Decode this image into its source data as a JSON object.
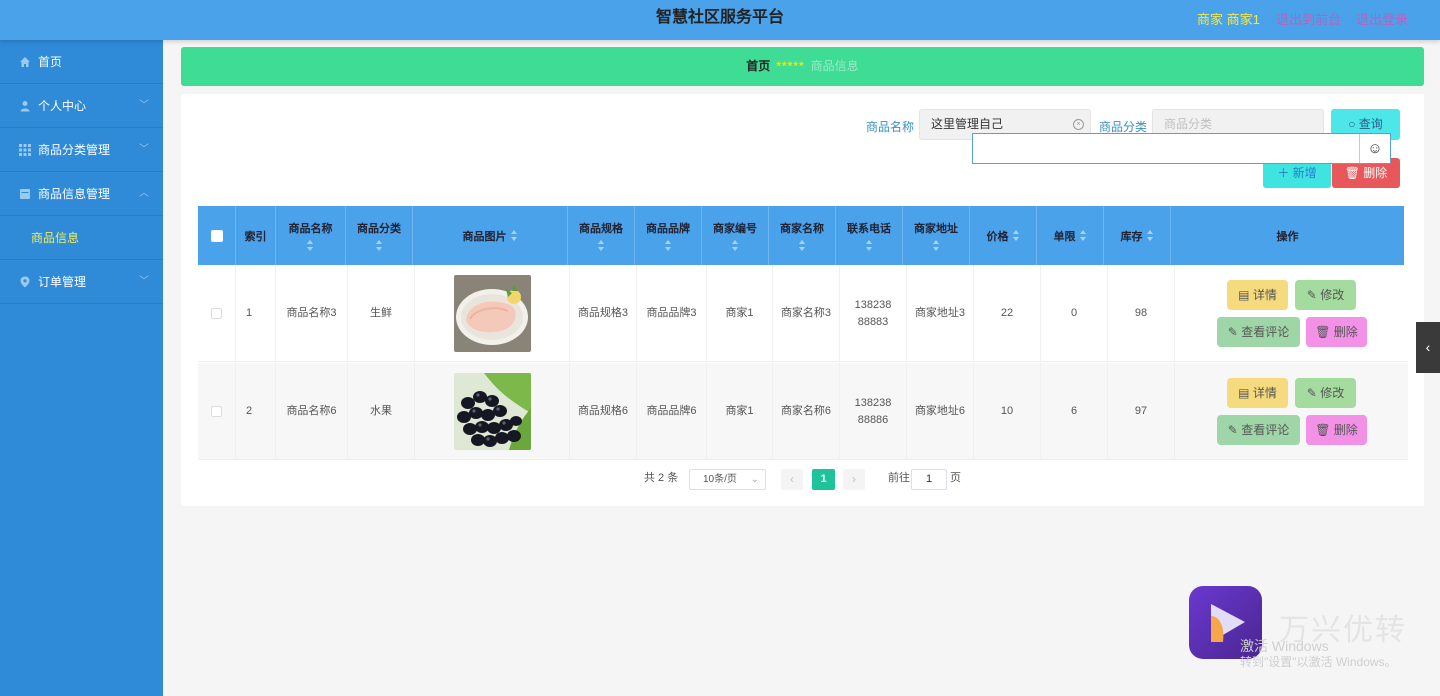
{
  "header": {
    "title": "智慧社区服务平台",
    "user": "商家 商家1",
    "back_link": "退出到前台",
    "logout_link": "退出登录"
  },
  "sidebar": {
    "items": [
      {
        "label": "首页",
        "icon": "home-icon"
      },
      {
        "label": "个人中心",
        "icon": "user-icon"
      },
      {
        "label": "商品分类管理",
        "icon": "grid-icon"
      },
      {
        "label": "商品信息管理",
        "icon": "box-icon"
      },
      {
        "label": "订单管理",
        "icon": "pin-icon"
      }
    ],
    "sub_item": "商品信息"
  },
  "breadcrumb": {
    "home": "首页",
    "separator": "*****",
    "current": "商品信息"
  },
  "search": {
    "name_label": "商品名称",
    "name_value": "这里管理自己",
    "category_label": "商品分类",
    "category_placeholder": "商品分类",
    "query_button": "查询"
  },
  "actions": {
    "add": "新增",
    "delete": "删除"
  },
  "table": {
    "headers": [
      "索引",
      "商品名称",
      "商品分类",
      "商品图片",
      "商品规格",
      "商品品牌",
      "商家编号",
      "商家名称",
      "联系电话",
      "商家地址",
      "价格",
      "单限",
      "库存",
      "操作"
    ],
    "rows": [
      {
        "index": "1",
        "name": "商品名称3",
        "category": "生鲜",
        "image": "chicken-breast",
        "spec": "商品规格3",
        "brand": "商品品牌3",
        "merchant_no": "商家1",
        "merchant_name": "商家名称3",
        "phone": "13823888883",
        "address": "商家地址3",
        "price": "22",
        "limit": "0",
        "stock": "98"
      },
      {
        "index": "2",
        "name": "商品名称6",
        "category": "水果",
        "image": "grapes",
        "spec": "商品规格6",
        "brand": "商品品牌6",
        "merchant_no": "商家1",
        "merchant_name": "商家名称6",
        "phone": "13823888886",
        "address": "商家地址6",
        "price": "10",
        "limit": "6",
        "stock": "97"
      }
    ],
    "row_buttons": {
      "detail": "详情",
      "edit": "修改",
      "comment": "查看评论",
      "delete": "删除"
    }
  },
  "pagination": {
    "total": "共 2 条",
    "page_size": "10条/页",
    "current_page": "1",
    "goto_label": "前往",
    "goto_value": "1",
    "page_suffix": "页"
  },
  "overlay": {
    "brand": "万兴优转",
    "activate_line1": "激活 Windows",
    "activate_line2": "转到\"设置\"以激活 Windows。"
  }
}
